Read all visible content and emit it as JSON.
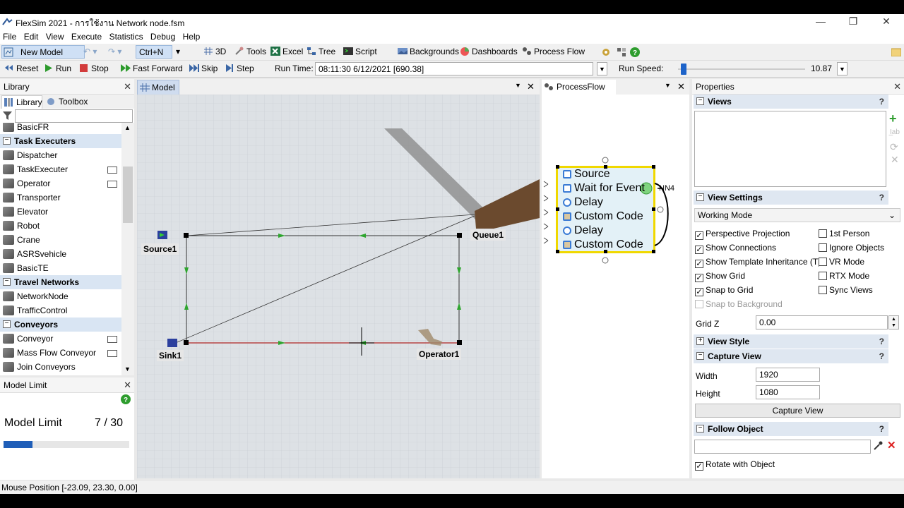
{
  "window": {
    "title": "FlexSim 2021 - การใช้งาน Network node.fsm"
  },
  "menu": [
    "File",
    "Edit",
    "View",
    "Execute",
    "Statistics",
    "Debug",
    "Help"
  ],
  "toolbar": {
    "new_model": "New Model",
    "shortcut": "Ctrl+N",
    "btn_3d": "3D",
    "tools": "Tools",
    "excel": "Excel",
    "tree": "Tree",
    "script": "Script",
    "backgrounds": "Backgrounds",
    "dashboards": "Dashboards",
    "process_flow": "Process Flow"
  },
  "runbar": {
    "reset": "Reset",
    "run": "Run",
    "stop": "Stop",
    "fast_forward": "Fast Forward",
    "skip": "Skip",
    "step": "Step",
    "run_time_label": "Run Time:",
    "run_time_value": "08:11:30  6/12/2021  [690.38]",
    "run_speed_label": "Run Speed:",
    "run_speed_value": "10.87",
    "run_speed_fraction": 0.02
  },
  "library": {
    "title": "Library",
    "tab_library": "Library",
    "tab_toolbox": "Toolbox",
    "search_value": "",
    "items": [
      {
        "type": "item",
        "label": "BasicFR",
        "icon": "basicfr-icon"
      },
      {
        "type": "cat",
        "label": "Task Executers"
      },
      {
        "type": "item",
        "label": "Dispatcher",
        "icon": "dispatcher-icon"
      },
      {
        "type": "item",
        "label": "TaskExecuter",
        "icon": "taskexecuter-icon"
      },
      {
        "type": "item",
        "label": "Operator",
        "icon": "operator-icon"
      },
      {
        "type": "item",
        "label": "Transporter",
        "icon": "transporter-icon"
      },
      {
        "type": "item",
        "label": "Elevator",
        "icon": "elevator-icon"
      },
      {
        "type": "item",
        "label": "Robot",
        "icon": "robot-icon"
      },
      {
        "type": "item",
        "label": "Crane",
        "icon": "crane-icon"
      },
      {
        "type": "item",
        "label": "ASRSvehicle",
        "icon": "asrs-icon"
      },
      {
        "type": "item",
        "label": "BasicTE",
        "icon": "basicte-icon"
      },
      {
        "type": "cat",
        "label": "Travel Networks"
      },
      {
        "type": "item",
        "label": "NetworkNode",
        "icon": "networknode-icon"
      },
      {
        "type": "item",
        "label": "TrafficControl",
        "icon": "trafficcontrol-icon"
      },
      {
        "type": "cat",
        "label": "Conveyors"
      },
      {
        "type": "item",
        "label": "Conveyor",
        "icon": "conveyor-icon"
      },
      {
        "type": "item",
        "label": "Mass Flow Conveyor",
        "icon": "massflow-icon"
      },
      {
        "type": "item",
        "label": "Join Conveyors",
        "icon": "joinconveyors-icon"
      }
    ]
  },
  "model_limit": {
    "title": "Model Limit",
    "label": "Model Limit",
    "value": "7 / 30",
    "fraction": 0.233
  },
  "model_view": {
    "tab": "Model",
    "objects": {
      "source": "Source1",
      "queue": "Queue1",
      "sink": "Sink1",
      "operator": "Operator1"
    }
  },
  "process_flow": {
    "tab": "ProcessFlow",
    "activities": [
      "Source",
      "Wait for Event",
      "Delay",
      "Custom Code",
      "Delay",
      "Custom Code"
    ],
    "annotation": "NN4"
  },
  "properties": {
    "title": "Properties",
    "views": "Views",
    "view_settings": "View Settings",
    "working_mode": "Working Mode",
    "left_checks": [
      {
        "label": "Perspective Projection",
        "checked": true
      },
      {
        "label": "Show Connections",
        "checked": true
      },
      {
        "label": "Show Template Inheritance (T)",
        "checked": true
      },
      {
        "label": "Show Grid",
        "checked": true
      },
      {
        "label": "Snap to Grid",
        "checked": true
      },
      {
        "label": "Snap to Background",
        "checked": false,
        "disabled": true
      }
    ],
    "right_checks": [
      {
        "label": "1st Person",
        "checked": false
      },
      {
        "label": "Ignore Objects",
        "checked": false
      },
      {
        "label": "VR Mode",
        "checked": false
      },
      {
        "label": "RTX Mode",
        "checked": false
      },
      {
        "label": "Sync Views",
        "checked": false
      }
    ],
    "grid_z_label": "Grid Z",
    "grid_z_value": "0.00",
    "view_style": "View Style",
    "capture_view": "Capture View",
    "width_label": "Width",
    "width_value": "1920",
    "height_label": "Height",
    "height_value": "1080",
    "capture_button": "Capture View",
    "follow_object": "Follow Object",
    "follow_value": "",
    "rotate_label": "Rotate with Object"
  },
  "status": {
    "mouse_position": "Mouse Position [-23.09, 23.30, 0.00]"
  }
}
